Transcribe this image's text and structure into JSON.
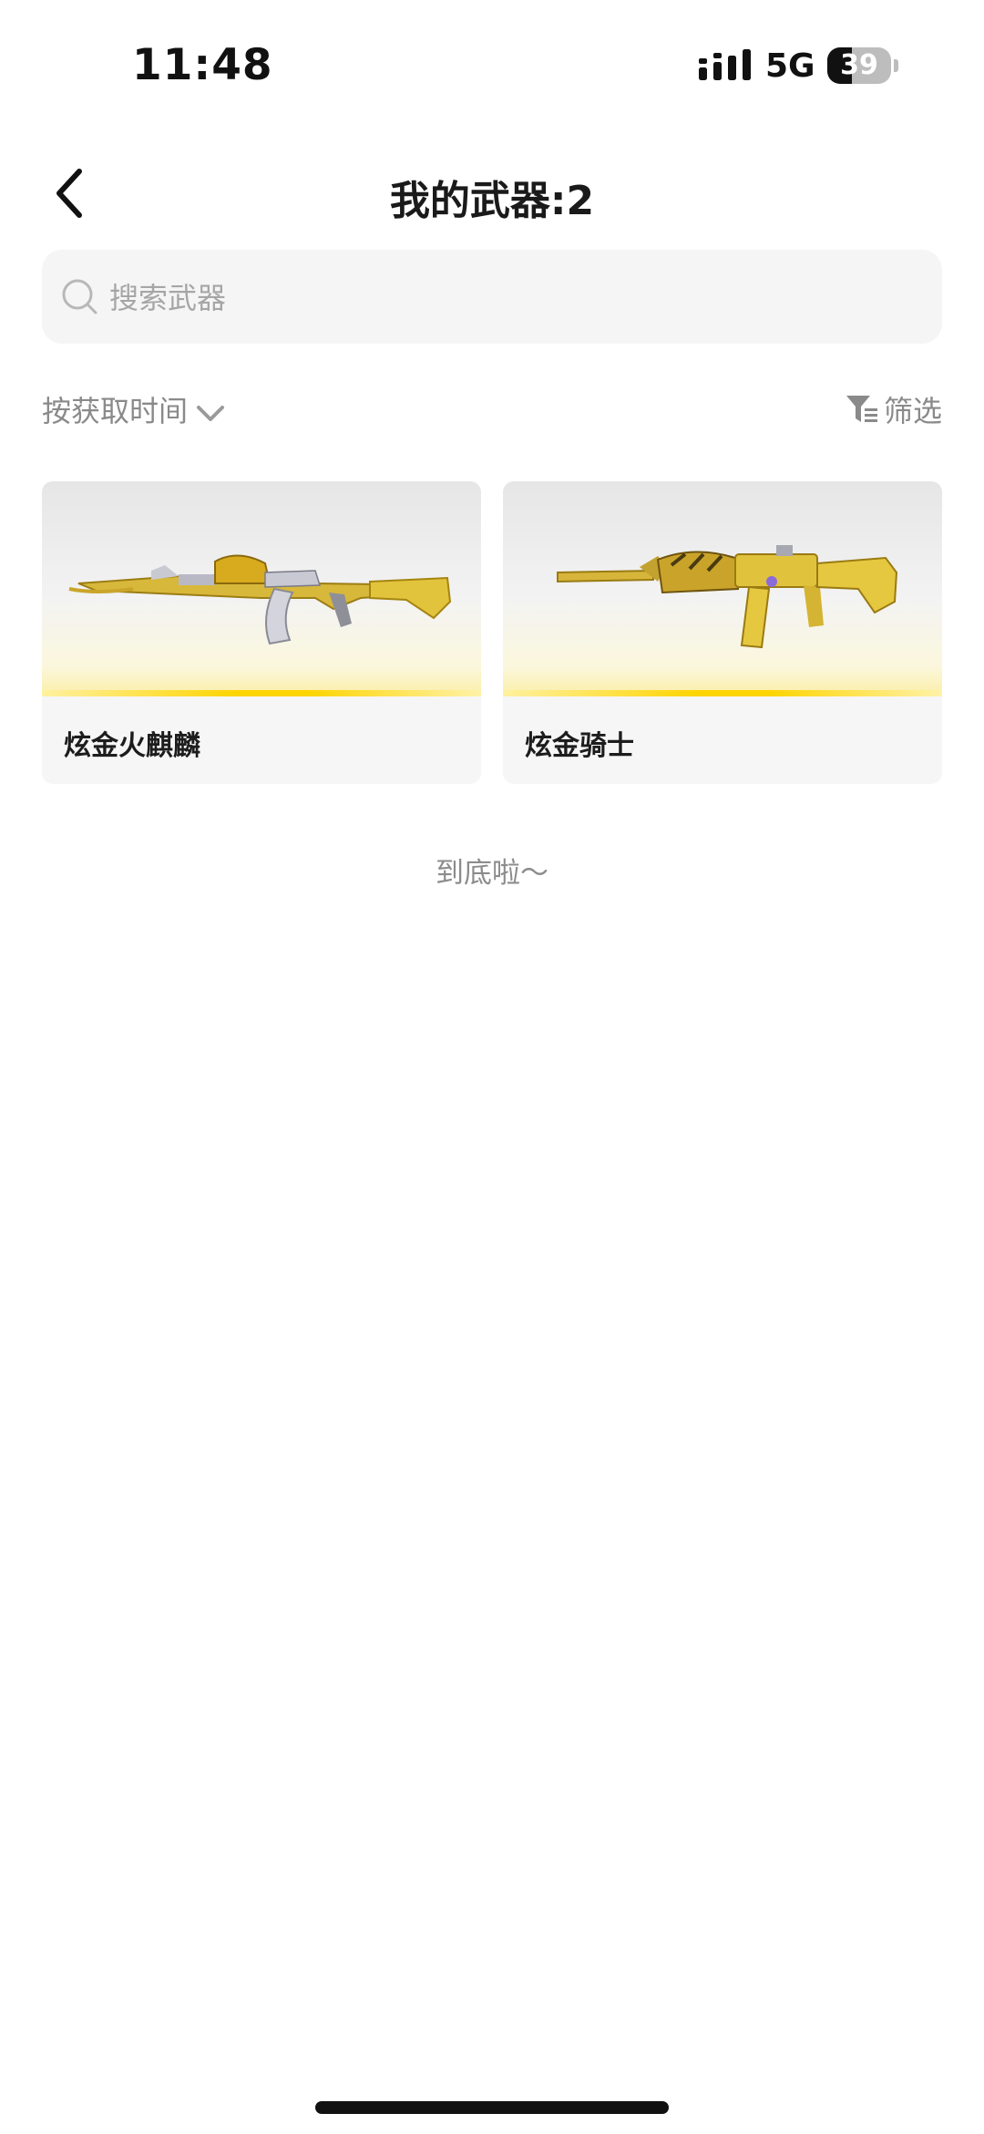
{
  "status": {
    "time": "11:48",
    "network": "5G",
    "battery": "39"
  },
  "header": {
    "title": "我的武器:2"
  },
  "search": {
    "placeholder": "搜索武器"
  },
  "toolbar": {
    "sort_label": "按获取时间",
    "filter_label": "筛选"
  },
  "weapons": [
    {
      "name": "炫金火麒麟",
      "icon": "ak-rifle-gold-dragon"
    },
    {
      "name": "炫金骑士",
      "icon": "m4-rifle-gold-knight"
    }
  ],
  "footer": {
    "end_text": "到底啦～"
  },
  "colors": {
    "accent": "#ffd400",
    "muted_text": "#8a8a8a",
    "search_bg": "#f5f5f5"
  }
}
